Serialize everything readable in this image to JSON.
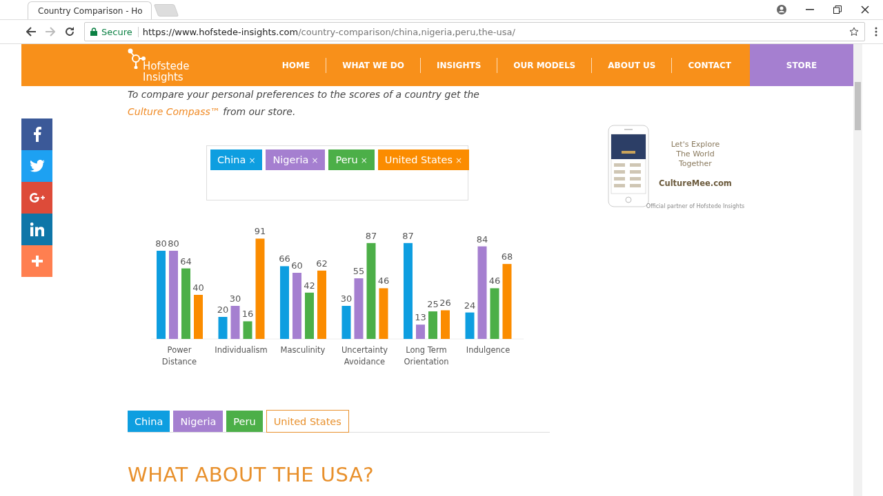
{
  "browser": {
    "tab_title": "Country Comparison - Ho",
    "secure_label": "Secure",
    "url_host": "https://www.hofstede-insights.com",
    "url_path": "/country-comparison/china,nigeria,peru,the-usa/"
  },
  "header": {
    "logo_line1": "Hofstede",
    "logo_line2": "Insights",
    "nav": [
      "HOME",
      "WHAT WE DO",
      "INSIGHTS",
      "OUR MODELS",
      "ABOUT US",
      "CONTACT"
    ],
    "store": "STORE"
  },
  "social": [
    {
      "kind": "facebook",
      "color": "#3b5998"
    },
    {
      "kind": "twitter",
      "color": "#1da1f2"
    },
    {
      "kind": "googleplus",
      "color": "#dd4b39"
    },
    {
      "kind": "linkedin",
      "color": "#0e76a8"
    },
    {
      "kind": "plus",
      "color": "#ff7f50"
    }
  ],
  "intro": {
    "text": "To compare your personal preferences to the scores of a country get the ",
    "link": "Culture Compass™",
    "rest": " from our store."
  },
  "selected_countries": [
    {
      "label": "China",
      "remove": "×",
      "color": "#0e9ee0"
    },
    {
      "label": "Nigeria",
      "remove": "×",
      "color": "#a57fd0"
    },
    {
      "label": "Peru",
      "remove": "×",
      "color": "#4caf48"
    },
    {
      "label": "United States",
      "remove": "×",
      "color": "#fb8c00"
    }
  ],
  "ad": {
    "line1": "Let's Explore",
    "line2": "The World",
    "line3": "Together",
    "site": "CultureMee.com",
    "note": "Official partner of Hofstede Insights"
  },
  "chart_data": {
    "type": "bar",
    "categories": [
      "Power Distance",
      "Individualism",
      "Masculinity",
      "Uncertainty Avoidance",
      "Long Term Orientation",
      "Indulgence"
    ],
    "data_labels": true,
    "series": [
      {
        "color": "#0e9ee0",
        "values": [
          80,
          20,
          66,
          30,
          87,
          24
        ]
      },
      {
        "color": "#a57fd0",
        "values": [
          80,
          30,
          60,
          55,
          13,
          84
        ]
      },
      {
        "color": "#4caf48",
        "values": [
          64,
          16,
          42,
          87,
          25,
          46
        ]
      },
      {
        "color": "#fb8c00",
        "values": [
          40,
          91,
          62,
          46,
          26,
          68
        ]
      }
    ]
  },
  "country_tabs": [
    {
      "label": "China",
      "selected": false,
      "color": "#0e9ee0"
    },
    {
      "label": "Nigeria",
      "selected": false,
      "color": "#a57fd0"
    },
    {
      "label": "Peru",
      "selected": false,
      "color": "#4caf48"
    },
    {
      "label": "United States",
      "selected": true,
      "color": "#e8902c"
    }
  ],
  "heading": "WHAT ABOUT THE USA?"
}
